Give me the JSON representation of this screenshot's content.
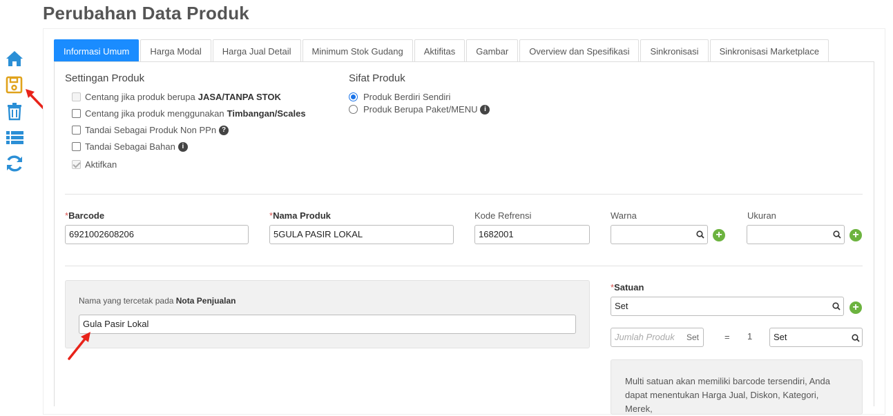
{
  "page": {
    "title": "Perubahan Data Produk"
  },
  "sidebar": {
    "icons": [
      "home-icon",
      "save-icon",
      "trash-icon",
      "list-icon",
      "refresh-icon"
    ]
  },
  "tabs": [
    {
      "label": "Informasi Umum",
      "active": true
    },
    {
      "label": "Harga Modal"
    },
    {
      "label": "Harga Jual Detail"
    },
    {
      "label": "Minimum Stok Gudang"
    },
    {
      "label": "Aktifitas"
    },
    {
      "label": "Gambar"
    },
    {
      "label": "Overview dan Spesifikasi"
    },
    {
      "label": "Sinkronisasi"
    },
    {
      "label": "Sinkronisasi Marketplace"
    }
  ],
  "settingan": {
    "title": "Settingan Produk",
    "items": [
      {
        "text": "Centang jika produk berupa",
        "bold": "JASA/TANPA STOK",
        "checked": false,
        "disabled": true
      },
      {
        "text": "Centang jika produk menggunakan",
        "bold": "Timbangan/Scales",
        "checked": false
      },
      {
        "text": "Tandai Sebagai Produk Non PPn",
        "checked": false,
        "icon": "question-icon"
      },
      {
        "text": "Tandai Sebagai Bahan",
        "checked": false,
        "icon": "info-icon"
      },
      {
        "text": "Aktifkan",
        "checked": true,
        "disabled": true
      }
    ]
  },
  "sifat": {
    "title": "Sifat Produk",
    "options": [
      {
        "label": "Produk Berdiri Sendiri",
        "selected": true
      },
      {
        "label": "Produk Berupa Paket/MENU",
        "selected": false
      }
    ]
  },
  "fields": {
    "barcode": {
      "label": "Barcode",
      "required": true,
      "value": "6921002608206"
    },
    "nama": {
      "label": "Nama Produk",
      "required": true,
      "value": "5GULA PASIR LOKAL"
    },
    "kode": {
      "label": "Kode Refrensi",
      "value": "1682001"
    },
    "warna": {
      "label": "Warna",
      "value": ""
    },
    "ukuran": {
      "label": "Ukuran",
      "value": ""
    }
  },
  "nota": {
    "label_prefix": "Nama yang tercetak pada",
    "label_bold": "Nota Penjualan",
    "value": "Gula Pasir Lokal"
  },
  "satuan": {
    "label": "Satuan",
    "value": "Set",
    "jumlah_placeholder": "Jumlah Produk",
    "jumlah_suffix": "Set",
    "equals": "=",
    "qty": "1",
    "unit_value": "Set",
    "multi_note": "Multi satuan akan memiliki barcode tersendiri, Anda dapat menentukan Harga Jual, Diskon, Kategori, Merek,"
  },
  "colors": {
    "accent": "#1a8cff",
    "sidebar_icon": "#2b8fd6",
    "save_icon": "#e0a21b",
    "plus": "#6cb33f",
    "arrow": "#e8231a"
  }
}
